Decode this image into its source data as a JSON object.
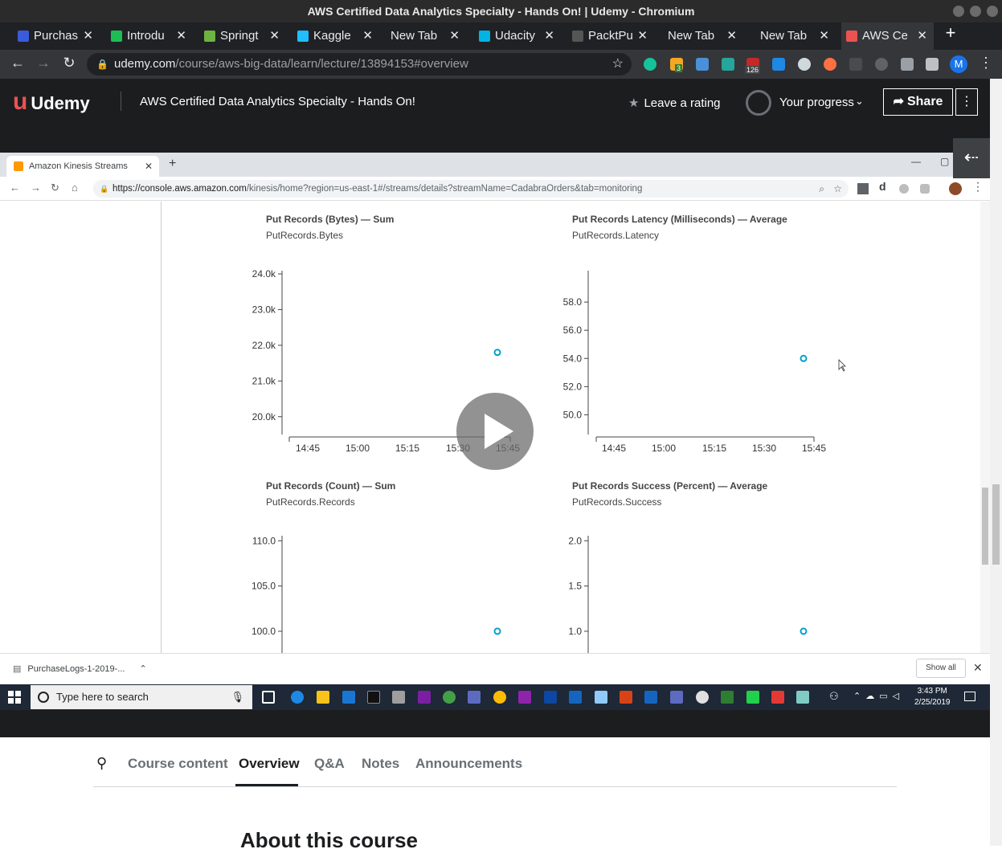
{
  "window": {
    "title": "AWS Certified Data Analytics Specialty - Hands On! | Udemy - Chromium"
  },
  "tabs": [
    {
      "label": "Purchas",
      "color": "#3b5bdb"
    },
    {
      "label": "Introdu",
      "color": "#1ebd53"
    },
    {
      "label": "Springt",
      "color": "#6db33f"
    },
    {
      "label": "Kaggle",
      "color": "#20beff"
    },
    {
      "label": "New Tab",
      "color": ""
    },
    {
      "label": "Udacity",
      "color": "#02b3e4"
    },
    {
      "label": "PacktPu",
      "color": "#333333"
    },
    {
      "label": "New Tab",
      "color": ""
    },
    {
      "label": "New Tab",
      "color": ""
    },
    {
      "label": "AWS Ce",
      "color": "#ec5252"
    }
  ],
  "toolbar": {
    "url_host": "udemy.com",
    "url_path": "/course/aws-big-data/learn/lecture/13894153#overview",
    "badge_3": "3",
    "badge_126": "126",
    "profile_initial": "M"
  },
  "udemy": {
    "logo": "Udemy",
    "course_title": "AWS Certified Data Analytics Specialty - Hands On!",
    "rating_label": "Leave a rating",
    "progress_label": "Your progress",
    "share_label": "Share"
  },
  "inner_browser": {
    "tab_title": "Amazon Kinesis Streams Manage",
    "url_host": "https://console.aws.amazon.com",
    "url_path": "/kinesis/home?region=us-east-1#/streams/details?streamName=CadabraOrders&tab=monitoring",
    "download_name": "PurchaseLogs-1-2019-...",
    "show_all": "Show all"
  },
  "taskbar": {
    "search_placeholder": "Type here to search",
    "time": "3:43 PM",
    "date": "2/25/2019"
  },
  "course_tabs": [
    "Course content",
    "Overview",
    "Q&A",
    "Notes",
    "Announcements"
  ],
  "about_heading": "About this course",
  "accent": "#00a1c9",
  "chart_data": [
    {
      "type": "scatter",
      "title": "Put Records (Bytes) — Sum",
      "subtitle": "PutRecords.Bytes",
      "ylim": [
        19500,
        24000
      ],
      "yticks": [
        "24.0k",
        "23.0k",
        "22.0k",
        "21.0k",
        "20.0k"
      ],
      "ytick_values": [
        24000,
        23000,
        22000,
        21000,
        20000
      ],
      "xticks": [
        "14:45",
        "15:00",
        "15:15",
        "15:30",
        "15:45"
      ],
      "points": [
        {
          "x": "15:40",
          "y": 21800
        }
      ]
    },
    {
      "type": "scatter",
      "title": "Put Records Latency (Milliseconds) — Average",
      "subtitle": "PutRecords.Latency",
      "ylim": [
        48.6,
        60.0
      ],
      "yticks": [
        "58.0",
        "56.0",
        "54.0",
        "52.0",
        "50.0"
      ],
      "ytick_values": [
        58,
        56,
        54,
        52,
        50
      ],
      "xticks": [
        "14:45",
        "15:00",
        "15:15",
        "15:30",
        "15:45"
      ],
      "points": [
        {
          "x": "15:40",
          "y": 54.0
        }
      ]
    },
    {
      "type": "scatter",
      "title": "Put Records (Count) — Sum",
      "subtitle": "PutRecords.Records",
      "ylim": [
        96,
        110.2
      ],
      "yticks": [
        "110.0",
        "105.0",
        "100.0"
      ],
      "ytick_values": [
        110,
        105,
        100
      ],
      "xticks": [],
      "points": [
        {
          "x": "15:40",
          "y": 100.0
        }
      ]
    },
    {
      "type": "scatter",
      "title": "Put Records Success (Percent) — Average",
      "subtitle": "PutRecords.Success",
      "ylim": [
        0.6,
        2.02
      ],
      "yticks": [
        "2.0",
        "1.5",
        "1.0"
      ],
      "ytick_values": [
        2.0,
        1.5,
        1.0
      ],
      "xticks": [],
      "points": [
        {
          "x": "15:40",
          "y": 1.0
        }
      ]
    }
  ]
}
